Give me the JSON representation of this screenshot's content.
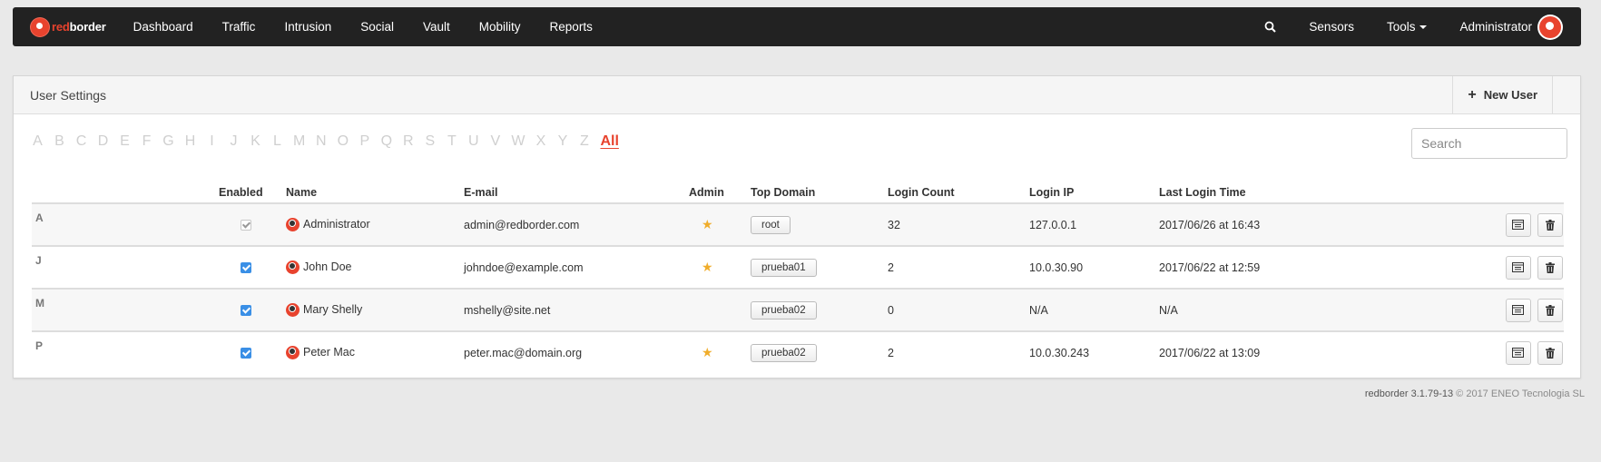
{
  "navbar": {
    "brand_red": "red",
    "brand_white": "border",
    "items": [
      "Dashboard",
      "Traffic",
      "Intrusion",
      "Social",
      "Vault",
      "Mobility",
      "Reports"
    ],
    "right": {
      "sensors": "Sensors",
      "tools": "Tools",
      "user": "Administrator"
    },
    "accent_color": "#e8432e"
  },
  "panel": {
    "title": "User Settings",
    "new_user_label": "New User",
    "search_placeholder": "Search",
    "alphabet": [
      "A",
      "B",
      "C",
      "D",
      "E",
      "F",
      "G",
      "H",
      "I",
      "J",
      "K",
      "L",
      "M",
      "N",
      "O",
      "P",
      "Q",
      "R",
      "S",
      "T",
      "U",
      "V",
      "W",
      "X",
      "Y",
      "Z"
    ],
    "alphabet_active": "All"
  },
  "table": {
    "columns": [
      "Enabled",
      "Name",
      "E-mail",
      "Admin",
      "Top Domain",
      "Login Count",
      "Login IP",
      "Last Login Time"
    ],
    "rows": [
      {
        "letter": "A",
        "enabled_disabled": true,
        "name": "Administrator",
        "email": "admin@redborder.com",
        "admin": true,
        "domain": "root",
        "login_count": "32",
        "login_ip": "127.0.0.1",
        "last_login": "2017/06/26 at 16:43"
      },
      {
        "letter": "J",
        "enabled_disabled": false,
        "name": "John Doe",
        "email": "johndoe@example.com",
        "admin": true,
        "domain": "prueba01",
        "login_count": "2",
        "login_ip": "10.0.30.90",
        "last_login": "2017/06/22 at 12:59"
      },
      {
        "letter": "M",
        "enabled_disabled": false,
        "name": "Mary Shelly",
        "email": "mshelly@site.net",
        "admin": false,
        "domain": "prueba02",
        "login_count": "0",
        "login_ip": "N/A",
        "last_login": "N/A"
      },
      {
        "letter": "P",
        "enabled_disabled": false,
        "name": "Peter Mac",
        "email": "peter.mac@domain.org",
        "admin": true,
        "domain": "prueba02",
        "login_count": "2",
        "login_ip": "10.0.30.243",
        "last_login": "2017/06/22 at 13:09"
      }
    ]
  },
  "footer": {
    "version": "redborder 3.1.79-13",
    "copyright": "© 2017 ENEO Tecnologia SL"
  }
}
